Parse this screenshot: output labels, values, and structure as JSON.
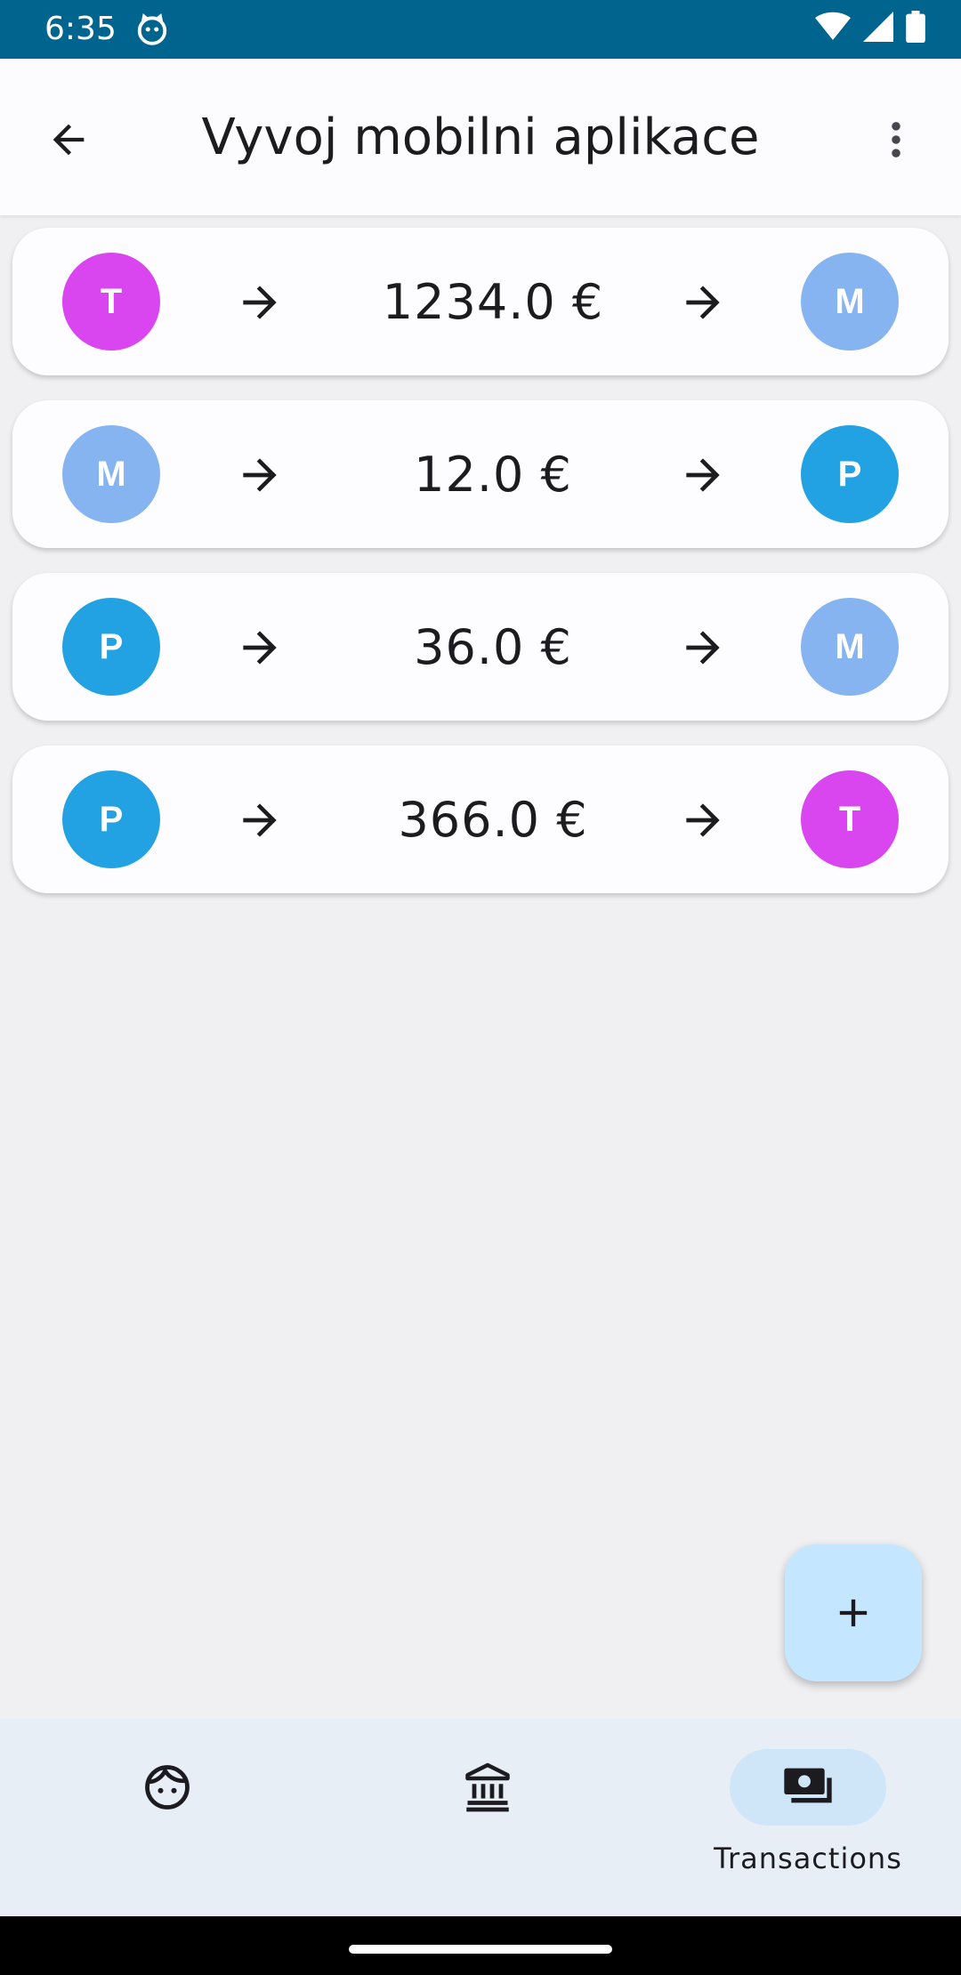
{
  "status_bar": {
    "time": "6:35"
  },
  "app_bar": {
    "title": "Vyvoj mobilni aplikace"
  },
  "transactions": [
    {
      "from": {
        "initial": "T",
        "color": "#d946ef"
      },
      "amount": "1234.0 €",
      "to": {
        "initial": "M",
        "color": "#85b4f0"
      }
    },
    {
      "from": {
        "initial": "M",
        "color": "#85b4f0"
      },
      "amount": "12.0 €",
      "to": {
        "initial": "P",
        "color": "#22a2e2"
      }
    },
    {
      "from": {
        "initial": "P",
        "color": "#22a2e2"
      },
      "amount": "36.0 €",
      "to": {
        "initial": "M",
        "color": "#85b4f0"
      }
    },
    {
      "from": {
        "initial": "P",
        "color": "#22a2e2"
      },
      "amount": "366.0 €",
      "to": {
        "initial": "T",
        "color": "#d946ef"
      }
    }
  ],
  "fab": {
    "icon": "plus-icon",
    "color": "#c4e7ff"
  },
  "bottom_nav": {
    "items": [
      {
        "icon": "face-icon",
        "label": ""
      },
      {
        "icon": "bank-icon",
        "label": ""
      },
      {
        "icon": "payments-icon",
        "label": "Transactions",
        "active": true
      }
    ]
  },
  "colors": {
    "status_bar": "#00658e",
    "background": "#f0f0f3",
    "nav_background": "#e7eef5"
  }
}
